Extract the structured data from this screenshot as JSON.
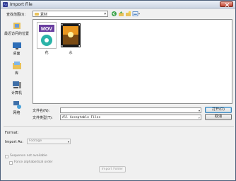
{
  "window": {
    "title": "Import File"
  },
  "lookin": {
    "label": "查找范围(I):",
    "value": "素材"
  },
  "places": [
    {
      "label": "最近访问的位置",
      "icon": "recent-places-icon"
    },
    {
      "label": "桌面",
      "icon": "desktop-icon"
    },
    {
      "label": "库",
      "icon": "libraries-icon"
    },
    {
      "label": "计算机",
      "icon": "computer-icon"
    },
    {
      "label": "网络",
      "icon": "network-icon"
    }
  ],
  "files": [
    {
      "name": "花",
      "icon": "mov-file-icon",
      "badge": "MOV"
    },
    {
      "name": "水",
      "icon": "video-file-icon"
    }
  ],
  "filename": {
    "label": "文件名(N):",
    "value": ""
  },
  "filetype": {
    "label": "文件类型(T):",
    "value": "All Acceptable Files"
  },
  "buttons": {
    "open": "打开(O)",
    "cancel": "取消"
  },
  "format": {
    "label": "Format:"
  },
  "import_as": {
    "label": "Import As:",
    "value": "Footage"
  },
  "options": {
    "sequence": "Sequence not available",
    "alphabetical": "Force alphabetical order",
    "import_folder": "Import Folder"
  },
  "colors": {
    "title_bar": "#cdd6e4",
    "close_button": "#c14532",
    "mov_badge": "#6a3fa0"
  }
}
